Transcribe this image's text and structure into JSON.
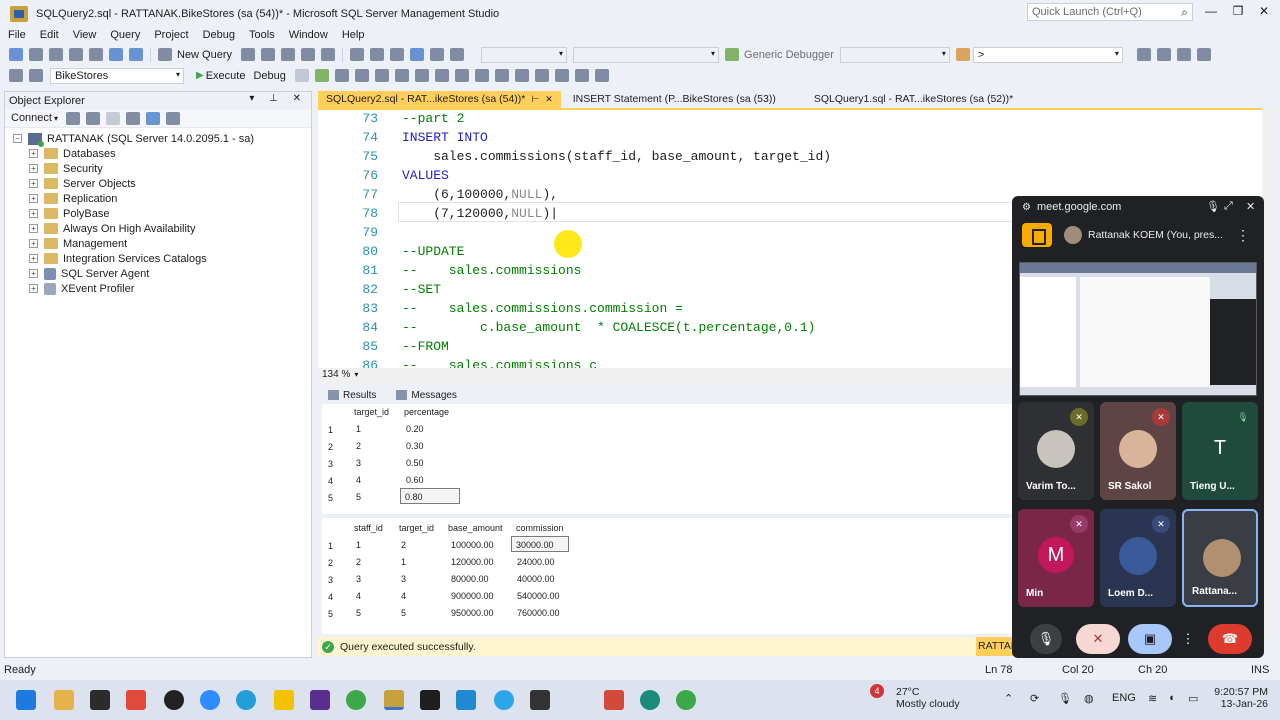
{
  "window": {
    "title": "SQLQuery2.sql - RATTANAK.BikeStores (sa (54))* - Microsoft SQL Server Management Studio",
    "quick_launch_placeholder": "Quick Launch (Ctrl+Q)"
  },
  "menu": [
    "File",
    "Edit",
    "View",
    "Query",
    "Project",
    "Debug",
    "Tools",
    "Window",
    "Help"
  ],
  "toolbar1": {
    "new_query": "New Query",
    "debugger": "Generic Debugger",
    "db_combo": ">"
  },
  "toolbar2": {
    "database": "BikeStores",
    "execute": "Execute",
    "debug": "Debug"
  },
  "object_explorer": {
    "title": "Object Explorer",
    "connect": "Connect",
    "server": "RATTANAK (SQL Server 14.0.2095.1 - sa)",
    "nodes": [
      "Databases",
      "Security",
      "Server Objects",
      "Replication",
      "PolyBase",
      "Always On High Availability",
      "Management",
      "Integration Services Catalogs",
      "SQL Server Agent",
      "XEvent Profiler"
    ]
  },
  "tabs": [
    {
      "label": "SQLQuery2.sql - RAT...ikeStores (sa (54))*"
    },
    {
      "label": "INSERT Statement (P...BikeStores (sa (53))"
    },
    {
      "label": "SQLQuery1.sql - RAT...ikeStores (sa (52))*"
    }
  ],
  "editor": {
    "line_numbers": [
      "73",
      "74",
      "75",
      "76",
      "77",
      "78",
      "79",
      "80",
      "81",
      "82",
      "83",
      "84",
      "85",
      "86"
    ],
    "zoom": "134 %"
  },
  "results": {
    "tabs": [
      "Results",
      "Messages"
    ],
    "grid1": {
      "columns": [
        "target_id",
        "percentage"
      ],
      "row_numbers": [
        "1",
        "2",
        "3",
        "4",
        "5"
      ],
      "rows": [
        [
          "1",
          "0.20"
        ],
        [
          "2",
          "0.30"
        ],
        [
          "3",
          "0.50"
        ],
        [
          "4",
          "0.60"
        ],
        [
          "5",
          "0.80"
        ]
      ]
    },
    "grid2": {
      "columns": [
        "staff_id",
        "target_id",
        "base_amount",
        "commission"
      ],
      "row_numbers": [
        "1",
        "2",
        "3",
        "4",
        "5"
      ],
      "rows": [
        [
          "1",
          "2",
          "100000.00",
          "30000.00"
        ],
        [
          "2",
          "1",
          "120000.00",
          "24000.00"
        ],
        [
          "3",
          "3",
          "80000.00",
          "40000.00"
        ],
        [
          "4",
          "4",
          "900000.00",
          "540000.00"
        ],
        [
          "5",
          "5",
          "950000.00",
          "760000.00"
        ]
      ]
    },
    "status": "Query executed successfully.",
    "server_short": "RATTAN"
  },
  "statusbar": {
    "ready": "Ready",
    "ln": "Ln 78",
    "col": "Col 20",
    "ch": "Ch 20",
    "ins": "INS"
  },
  "meet": {
    "url": "meet.google.com",
    "presenter": "Rattanak KOEM (You, pres...",
    "participants": [
      {
        "name": "Varim To...",
        "initial": ""
      },
      {
        "name": "SR Sakol",
        "initial": ""
      },
      {
        "name": "Tieng U...",
        "initial": "T"
      },
      {
        "name": "Min",
        "initial": "M"
      },
      {
        "name": "Loem D...",
        "initial": ""
      },
      {
        "name": "Rattana...",
        "initial": ""
      }
    ]
  },
  "taskbar": {
    "weather_temp": "27°C",
    "weather_desc": "Mostly cloudy",
    "weather_badge": "4",
    "lang": "ENG",
    "time": "9:20:57 PM",
    "date": "13-Jan-26"
  }
}
